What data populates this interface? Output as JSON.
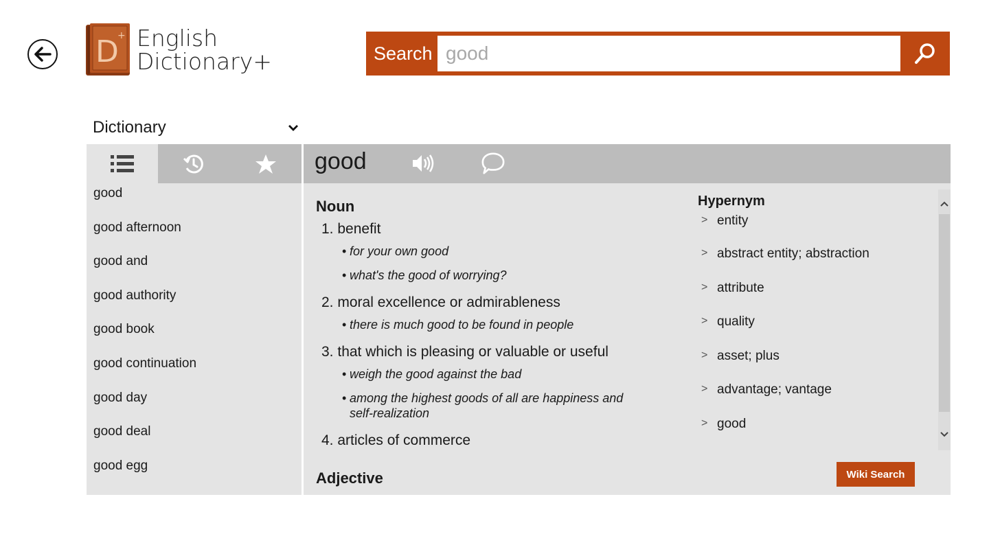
{
  "app": {
    "title_line1": "English",
    "title_line2": "Dictionary+",
    "logo_letter": "D"
  },
  "colors": {
    "accent": "#bd4812",
    "panel_bg": "#e4e4e4",
    "header_bg": "#bcbcbc"
  },
  "search": {
    "label": "Search",
    "value": "good",
    "placeholder": "good"
  },
  "mode": {
    "selected": "Dictionary"
  },
  "left_tabs": [
    {
      "icon": "list-icon",
      "active": true
    },
    {
      "icon": "history-icon",
      "active": false
    },
    {
      "icon": "star-icon",
      "active": false
    }
  ],
  "word_list": [
    "good",
    "good afternoon",
    "good and",
    "good authority",
    "good book",
    "good continuation",
    "good day",
    "good deal",
    "good egg"
  ],
  "entry": {
    "word": "good",
    "sections": [
      {
        "pos": "Noun",
        "senses": [
          {
            "num": "1.",
            "text": "benefit",
            "examples": [
              "for your own good",
              "what's the good of worrying?"
            ]
          },
          {
            "num": "2.",
            "text": "moral excellence or admirableness",
            "examples": [
              "there is much good to be found in people"
            ]
          },
          {
            "num": "3.",
            "text": "that which is pleasing or valuable or useful",
            "examples": [
              "weigh the good against the bad",
              "among the highest goods of all are happiness and self-realization"
            ]
          },
          {
            "num": "4.",
            "text": "articles of commerce",
            "examples": []
          }
        ]
      },
      {
        "pos": "Adjective",
        "senses": []
      }
    ]
  },
  "hypernym": {
    "title": "Hypernym",
    "arrow": ">",
    "items": [
      "entity",
      "abstract entity; abstraction",
      "attribute",
      "quality",
      "asset; plus",
      "advantage; vantage",
      "good"
    ]
  },
  "wiki_button": "Wiki Search"
}
